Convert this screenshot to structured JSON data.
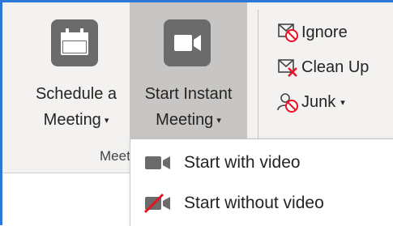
{
  "ribbon": {
    "schedule_meeting": {
      "line1": "Schedule a",
      "line2": "Meeting",
      "caret": "▾"
    },
    "start_instant_meeting": {
      "line1": "Start Instant",
      "line2": "Meeting",
      "caret": "▾"
    },
    "group_label": "Meetings",
    "ignore_label": "Ignore",
    "clean_up_label": "Clean Up",
    "junk_label": "Junk",
    "junk_caret": "▾"
  },
  "dropdown": {
    "items": [
      {
        "label": "Start with video",
        "icon": "video-camera-icon"
      },
      {
        "label": "Start without video",
        "icon": "video-off-icon"
      }
    ]
  },
  "colors": {
    "ribbon_bg": "#f3f2f1",
    "pressed_bg": "#c8c6c4",
    "icon_gray": "#6b6b6b",
    "red_accent": "#e81123",
    "frame_blue": "#2b78d8"
  }
}
